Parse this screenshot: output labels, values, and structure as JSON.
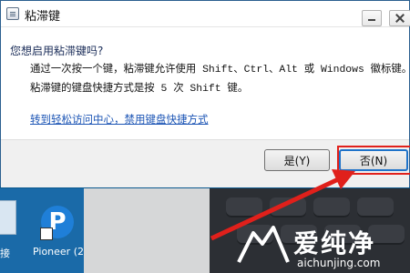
{
  "dialog": {
    "title": "粘滞键",
    "question": "您想启用粘滞键吗?",
    "description": "通过一次按一个键，粘滞键允许使用 Shift、Ctrl、Alt 或 Windows 徽标键。启\n粘滞键的键盘快捷方式是按 5 次 Shift 键。",
    "link": "转到轻松访问中心，禁用键盘快捷方式",
    "buttons": {
      "yes": "是(Y)",
      "no": "否(N)"
    }
  },
  "desktop": {
    "left_label": "接",
    "pioneer_label": "Pioneer (2",
    "pioneer_icon_letter": "P"
  },
  "watermark": {
    "text": "爱纯净",
    "url": "aichunjing.com"
  },
  "colors": {
    "annotation": "#e0201b",
    "link": "#1c55b5",
    "desktop": "#0b5a8f"
  }
}
